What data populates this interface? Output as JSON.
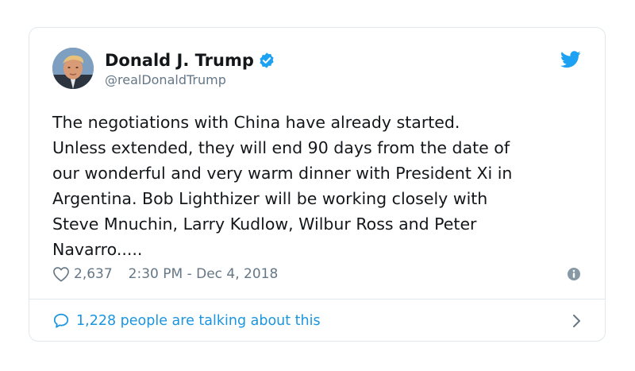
{
  "tweet": {
    "display_name": "Donald J. Trump",
    "handle": "@realDonaldTrump",
    "text": "The negotiations with China have already started.\nUnless extended, they will end 90 days from the date of\nour wonderful and very warm dinner with President Xi in\nArgentina. Bob Lighthizer will be working closely with\nSteve Mnuchin, Larry Kudlow, Wilbur Ross and Peter\nNavarro.....",
    "like_count": "2,637",
    "timestamp": "2:30 PM - Dec 4, 2018",
    "talking_text": "1,228 people are talking about this"
  },
  "icons": {
    "verified": "verified-badge-icon",
    "brand": "twitter-bird-icon",
    "like": "heart-icon",
    "info": "info-icon",
    "reply": "speech-bubble-icon",
    "more": "chevron-right-icon"
  },
  "colors": {
    "accent": "#1da1f2",
    "link": "#1b95e0",
    "muted": "#657786",
    "text": "#14171a",
    "border": "#e1e8ed"
  }
}
